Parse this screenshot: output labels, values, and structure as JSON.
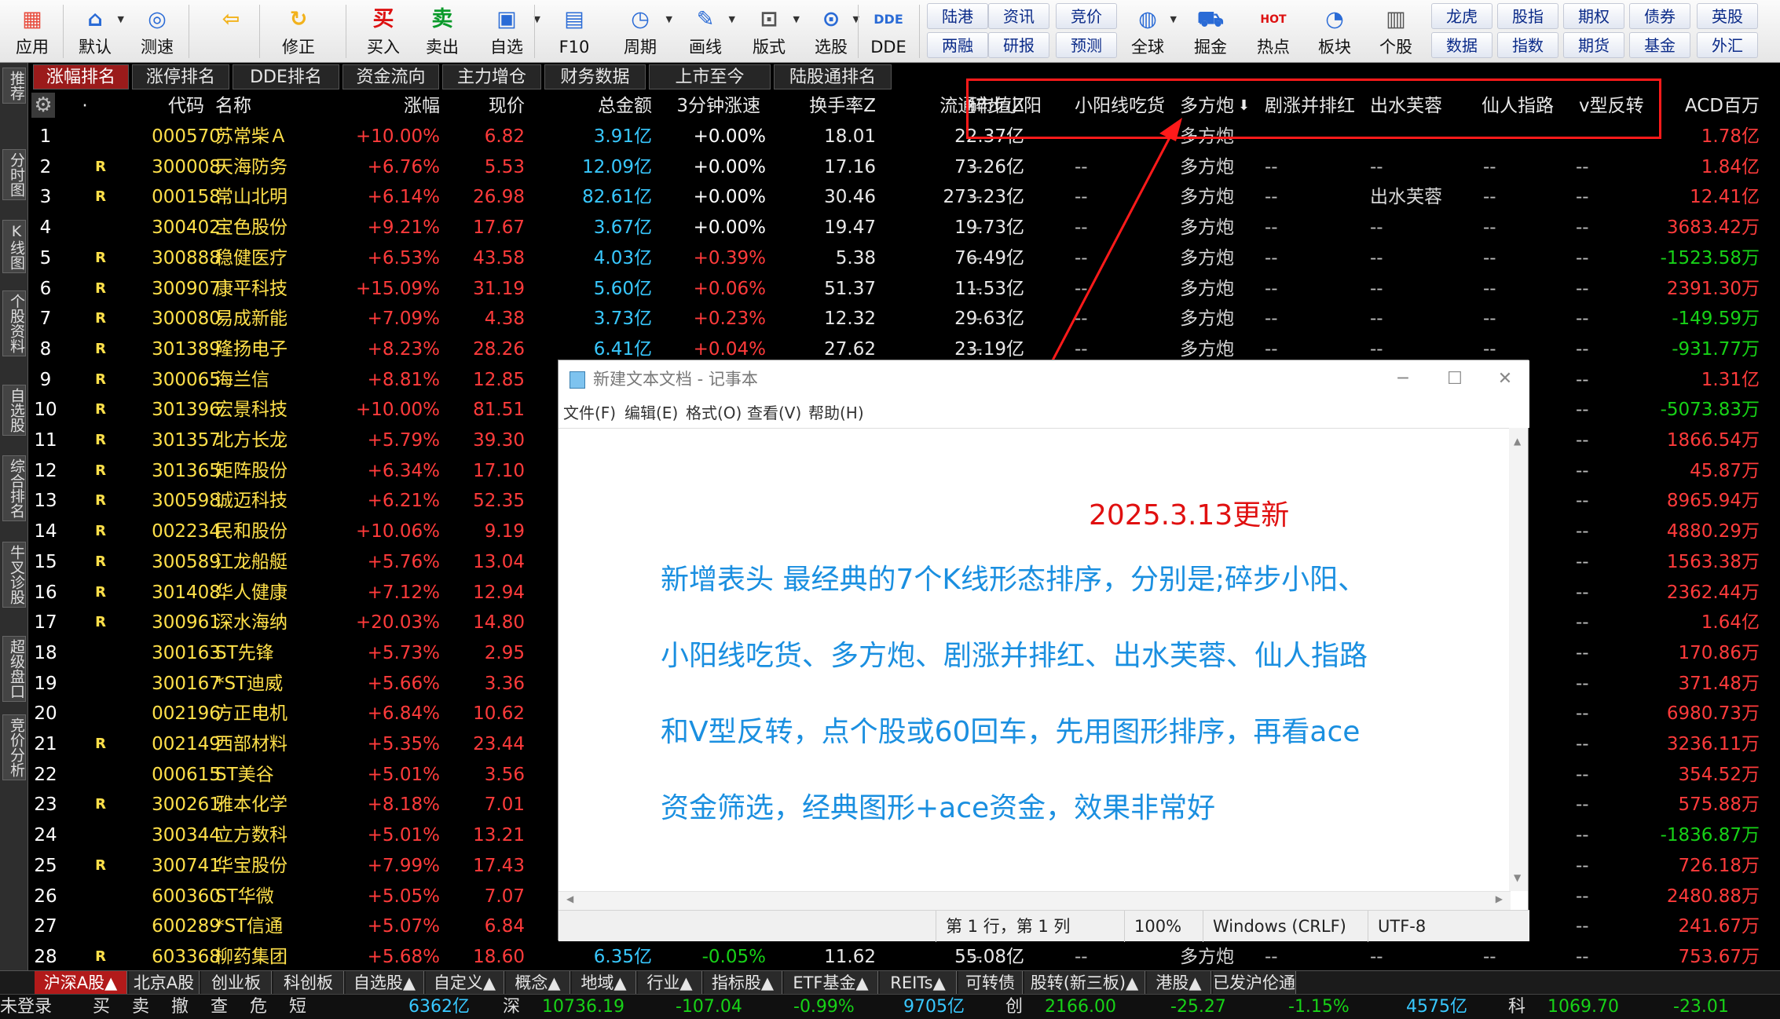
{
  "colors": {
    "up": "#ff3b3b",
    "down": "#17d217",
    "flat": "#ffffff",
    "amount": "#38c8ff",
    "code": "#ffe04a",
    "name": "#ffe04a",
    "idx": "#ffffff",
    "r": "#ffe04a",
    "pattern": "#d8d8d8",
    "dash": "#bbbbbb",
    "highlight": "#ff1a1a",
    "active_tab": "#9b1b1b"
  },
  "toolbar": {
    "items": [
      {
        "label": "应用",
        "icon": "apps-icon",
        "glyph": "▦",
        "color": "#e84b3c"
      },
      {
        "label": "默认",
        "icon": "home-icon",
        "glyph": "⌂",
        "color": "#2a6bd6"
      },
      {
        "label": "测速",
        "icon": "speed-icon",
        "glyph": "◎",
        "color": "#2a6bd6"
      },
      {
        "label": "",
        "icon": "back-arrow-icon",
        "glyph": "⇦",
        "color": "#f2b21c"
      },
      {
        "label": "修正",
        "icon": "correct-icon",
        "glyph": "↻",
        "color": "#f2b21c"
      },
      {
        "label": "买入",
        "icon": "buy-icon",
        "glyph": "买",
        "color": "#d11"
      },
      {
        "label": "卖出",
        "icon": "sell-icon",
        "glyph": "卖",
        "color": "#0a9a2a"
      },
      {
        "label": "自选",
        "icon": "watchlist-icon",
        "glyph": "▣",
        "color": "#2a6bd6"
      },
      {
        "label": "F10",
        "icon": "f10-icon",
        "glyph": "▤",
        "color": "#2a6bd6"
      },
      {
        "label": "周期",
        "icon": "period-icon",
        "glyph": "◷",
        "color": "#2a6bd6"
      },
      {
        "label": "画线",
        "icon": "draw-line-icon",
        "glyph": "✎",
        "color": "#2a6bd6"
      },
      {
        "label": "版式",
        "icon": "layout-icon",
        "glyph": "⊡",
        "color": "#555"
      },
      {
        "label": "选股",
        "icon": "stock-pick-icon",
        "glyph": "⊙",
        "color": "#2a6bd6"
      },
      {
        "label": "DDE",
        "icon": "dde-icon",
        "glyph": "DDE",
        "color": "#2a6bd6"
      }
    ],
    "quick": [
      [
        "陆港",
        "两融"
      ],
      [
        "资讯",
        "研报"
      ],
      [
        "竞价",
        "预测"
      ]
    ],
    "items2": [
      {
        "label": "全球",
        "icon": "globe-icon",
        "glyph": "◍",
        "color": "#2a6bd6"
      },
      {
        "label": "掘金",
        "icon": "cart-icon",
        "glyph": "⛟",
        "color": "#2a6bd6"
      },
      {
        "label": "热点",
        "icon": "hot-icon",
        "glyph": "HOT",
        "color": "#d11"
      },
      {
        "label": "板块",
        "icon": "sector-pie-icon",
        "glyph": "◔",
        "color": "#2a6bd6"
      },
      {
        "label": "个股",
        "icon": "stock-doc-icon",
        "glyph": "▥",
        "color": "#555"
      }
    ],
    "quick2": [
      [
        "龙虎",
        "数据"
      ],
      [
        "股指",
        "指数"
      ],
      [
        "期权",
        "期货"
      ],
      [
        "债券",
        "基金"
      ],
      [
        "英股",
        "外汇"
      ]
    ]
  },
  "sidenav": [
    "推荐",
    "分时图",
    "K线图",
    "个股资料",
    "自选股",
    "综合排名",
    "牛叉诊股",
    "超级盘口",
    "竞价分析"
  ],
  "tabs": [
    "涨幅排名",
    "涨停排名",
    "DDE排名",
    "资金流向",
    "主力增仓",
    "财务数据",
    "上市至今",
    "陆股通排名"
  ],
  "header": [
    "·",
    "代码",
    "名称",
    "涨幅",
    "现价",
    "总金额",
    "3分钟涨速",
    "换手率Z",
    "流通市值Z",
    "碎步小阳",
    "小阳线吃货",
    "多方炮",
    "剧涨并排红",
    "出水芙蓉",
    "仙人指路",
    "v型反转",
    "ACD百万"
  ],
  "rows": [
    {
      "idx": "1",
      "r": "",
      "code": "000570",
      "name": "苏常柴Ａ",
      "chg": "+10.00%",
      "price": "6.82",
      "amt": "3.91亿",
      "speed": "+0.00%",
      "turn": "18.01",
      "mcap": "22.37亿",
      "p1": "",
      "p2": "",
      "p3": "多方炮",
      "p4": "",
      "p5": "",
      "p6": "",
      "p7": "",
      "acd": "1.78亿",
      "acdc": "up"
    },
    {
      "idx": "2",
      "r": "R",
      "code": "300008",
      "name": "天海防务",
      "chg": "+6.76%",
      "price": "5.53",
      "amt": "12.09亿",
      "speed": "+0.00%",
      "turn": "17.16",
      "mcap": "73.26亿",
      "p1": "--",
      "p2": "--",
      "p3": "多方炮",
      "p4": "--",
      "p5": "--",
      "p6": "--",
      "p7": "--",
      "acd": "1.84亿",
      "acdc": "up"
    },
    {
      "idx": "3",
      "r": "R",
      "code": "000158",
      "name": "常山北明",
      "chg": "+6.14%",
      "price": "26.98",
      "amt": "82.61亿",
      "speed": "+0.00%",
      "turn": "30.46",
      "mcap": "273.23亿",
      "p1": "--",
      "p2": "--",
      "p3": "多方炮",
      "p4": "--",
      "p5": "出水芙蓉",
      "p6": "--",
      "p7": "--",
      "acd": "12.41亿",
      "acdc": "up"
    },
    {
      "idx": "4",
      "r": "",
      "code": "300402",
      "name": "宝色股份",
      "chg": "+9.21%",
      "price": "17.67",
      "amt": "3.67亿",
      "speed": "+0.00%",
      "turn": "19.47",
      "mcap": "19.73亿",
      "p1": "--",
      "p2": "--",
      "p3": "多方炮",
      "p4": "--",
      "p5": "--",
      "p6": "--",
      "p7": "--",
      "acd": "3683.42万",
      "acdc": "up"
    },
    {
      "idx": "5",
      "r": "R",
      "code": "300888",
      "name": "稳健医疗",
      "chg": "+6.53%",
      "price": "43.58",
      "amt": "4.03亿",
      "speed": "+0.39%",
      "turn": "5.38",
      "mcap": "76.49亿",
      "p1": "--",
      "p2": "--",
      "p3": "多方炮",
      "p4": "--",
      "p5": "--",
      "p6": "--",
      "p7": "--",
      "acd": "-1523.58万",
      "acdc": "down"
    },
    {
      "idx": "6",
      "r": "R",
      "code": "300907",
      "name": "康平科技",
      "chg": "+15.09%",
      "price": "31.19",
      "amt": "5.60亿",
      "speed": "+0.06%",
      "turn": "51.37",
      "mcap": "11.53亿",
      "p1": "--",
      "p2": "--",
      "p3": "多方炮",
      "p4": "--",
      "p5": "--",
      "p6": "--",
      "p7": "--",
      "acd": "2391.30万",
      "acdc": "up"
    },
    {
      "idx": "7",
      "r": "R",
      "code": "300080",
      "name": "易成新能",
      "chg": "+7.09%",
      "price": "4.38",
      "amt": "3.73亿",
      "speed": "+0.23%",
      "turn": "12.32",
      "mcap": "29.63亿",
      "p1": "--",
      "p2": "--",
      "p3": "多方炮",
      "p4": "--",
      "p5": "--",
      "p6": "--",
      "p7": "--",
      "acd": "-149.59万",
      "acdc": "down"
    },
    {
      "idx": "8",
      "r": "R",
      "code": "301389",
      "name": "隆扬电子",
      "chg": "+8.23%",
      "price": "28.26",
      "amt": "6.41亿",
      "speed": "+0.04%",
      "turn": "27.62",
      "mcap": "23.19亿",
      "p1": "--",
      "p2": "--",
      "p3": "多方炮",
      "p4": "--",
      "p5": "--",
      "p6": "--",
      "p7": "--",
      "acd": "-931.77万",
      "acdc": "down"
    },
    {
      "idx": "9",
      "r": "R",
      "code": "300065",
      "name": "海兰信",
      "chg": "+8.81%",
      "price": "12.85",
      "amt": "",
      "speed": "",
      "turn": "",
      "mcap": "",
      "p1": "",
      "p2": "",
      "p3": "",
      "p4": "",
      "p5": "",
      "p6": "",
      "p7": "--",
      "acd": "1.31亿",
      "acdc": "up"
    },
    {
      "idx": "10",
      "r": "R",
      "code": "301396",
      "name": "宏景科技",
      "chg": "+10.00%",
      "price": "81.51",
      "amt": "",
      "speed": "",
      "turn": "",
      "mcap": "",
      "p1": "",
      "p2": "",
      "p3": "",
      "p4": "",
      "p5": "",
      "p6": "",
      "p7": "--",
      "acd": "-5073.83万",
      "acdc": "down"
    },
    {
      "idx": "11",
      "r": "R",
      "code": "301357",
      "name": "北方长龙",
      "chg": "+5.79%",
      "price": "39.30",
      "amt": "",
      "speed": "",
      "turn": "",
      "mcap": "",
      "p1": "",
      "p2": "",
      "p3": "",
      "p4": "",
      "p5": "",
      "p6": "",
      "p7": "--",
      "acd": "1866.54万",
      "acdc": "up"
    },
    {
      "idx": "12",
      "r": "R",
      "code": "301365",
      "name": "矩阵股份",
      "chg": "+6.34%",
      "price": "17.10",
      "amt": "",
      "speed": "",
      "turn": "",
      "mcap": "",
      "p1": "",
      "p2": "",
      "p3": "",
      "p4": "",
      "p5": "",
      "p6": "",
      "p7": "--",
      "acd": "45.87万",
      "acdc": "up"
    },
    {
      "idx": "13",
      "r": "R",
      "code": "300598",
      "name": "诚迈科技",
      "chg": "+6.21%",
      "price": "52.35",
      "amt": "",
      "speed": "",
      "turn": "",
      "mcap": "",
      "p1": "",
      "p2": "",
      "p3": "",
      "p4": "",
      "p5": "",
      "p6": "",
      "p7": "--",
      "acd": "8965.94万",
      "acdc": "up"
    },
    {
      "idx": "14",
      "r": "R",
      "code": "002234",
      "name": "民和股份",
      "chg": "+10.06%",
      "price": "9.19",
      "amt": "",
      "speed": "",
      "turn": "",
      "mcap": "",
      "p1": "",
      "p2": "",
      "p3": "",
      "p4": "",
      "p5": "",
      "p6": "",
      "p7": "--",
      "acd": "4880.29万",
      "acdc": "up"
    },
    {
      "idx": "15",
      "r": "R",
      "code": "300589",
      "name": "江龙船艇",
      "chg": "+5.76%",
      "price": "13.04",
      "amt": "",
      "speed": "",
      "turn": "",
      "mcap": "",
      "p1": "",
      "p2": "",
      "p3": "",
      "p4": "",
      "p5": "",
      "p6": "",
      "p7": "--",
      "acd": "1563.38万",
      "acdc": "up"
    },
    {
      "idx": "16",
      "r": "R",
      "code": "301408",
      "name": "华人健康",
      "chg": "+7.12%",
      "price": "12.94",
      "amt": "",
      "speed": "",
      "turn": "",
      "mcap": "",
      "p1": "",
      "p2": "",
      "p3": "",
      "p4": "",
      "p5": "",
      "p6": "",
      "p7": "--",
      "acd": "2362.44万",
      "acdc": "up"
    },
    {
      "idx": "17",
      "r": "R",
      "code": "300961",
      "name": "深水海纳",
      "chg": "+20.03%",
      "price": "14.80",
      "amt": "",
      "speed": "",
      "turn": "",
      "mcap": "",
      "p1": "",
      "p2": "",
      "p3": "",
      "p4": "",
      "p5": "",
      "p6": "",
      "p7": "--",
      "acd": "1.64亿",
      "acdc": "up"
    },
    {
      "idx": "18",
      "r": "",
      "code": "300163",
      "name": "ST先锋",
      "chg": "+5.73%",
      "price": "2.95",
      "amt": "",
      "speed": "",
      "turn": "",
      "mcap": "",
      "p1": "",
      "p2": "",
      "p3": "",
      "p4": "",
      "p5": "",
      "p6": "",
      "p7": "--",
      "acd": "170.86万",
      "acdc": "up"
    },
    {
      "idx": "19",
      "r": "",
      "code": "300167",
      "name": "*ST迪威",
      "chg": "+5.66%",
      "price": "3.36",
      "amt": "",
      "speed": "",
      "turn": "",
      "mcap": "",
      "p1": "",
      "p2": "",
      "p3": "",
      "p4": "",
      "p5": "",
      "p6": "",
      "p7": "--",
      "acd": "371.48万",
      "acdc": "up"
    },
    {
      "idx": "20",
      "r": "",
      "code": "002196",
      "name": "方正电机",
      "chg": "+6.84%",
      "price": "10.62",
      "amt": "",
      "speed": "",
      "turn": "",
      "mcap": "",
      "p1": "",
      "p2": "",
      "p3": "",
      "p4": "",
      "p5": "",
      "p6": "",
      "p7": "--",
      "acd": "6980.73万",
      "acdc": "up"
    },
    {
      "idx": "21",
      "r": "R",
      "code": "002149",
      "name": "西部材料",
      "chg": "+5.35%",
      "price": "23.44",
      "amt": "",
      "speed": "",
      "turn": "",
      "mcap": "",
      "p1": "",
      "p2": "",
      "p3": "",
      "p4": "",
      "p5": "",
      "p6": "",
      "p7": "--",
      "acd": "3236.11万",
      "acdc": "up"
    },
    {
      "idx": "22",
      "r": "",
      "code": "000615",
      "name": "ST美谷",
      "chg": "+5.01%",
      "price": "3.56",
      "amt": "",
      "speed": "",
      "turn": "",
      "mcap": "",
      "p1": "",
      "p2": "",
      "p3": "",
      "p4": "",
      "p5": "",
      "p6": "",
      "p7": "--",
      "acd": "354.52万",
      "acdc": "up"
    },
    {
      "idx": "23",
      "r": "R",
      "code": "300261",
      "name": "雅本化学",
      "chg": "+8.18%",
      "price": "7.01",
      "amt": "",
      "speed": "",
      "turn": "",
      "mcap": "",
      "p1": "",
      "p2": "",
      "p3": "",
      "p4": "",
      "p5": "",
      "p6": "",
      "p7": "--",
      "acd": "575.88万",
      "acdc": "up"
    },
    {
      "idx": "24",
      "r": "",
      "code": "300344",
      "name": "立方数科",
      "chg": "+5.01%",
      "price": "13.21",
      "amt": "",
      "speed": "",
      "turn": "",
      "mcap": "",
      "p1": "",
      "p2": "",
      "p3": "",
      "p4": "",
      "p5": "",
      "p6": "",
      "p7": "--",
      "acd": "-1836.87万",
      "acdc": "down"
    },
    {
      "idx": "25",
      "r": "R",
      "code": "300741",
      "name": "华宝股份",
      "chg": "+7.99%",
      "price": "17.43",
      "amt": "",
      "speed": "",
      "turn": "",
      "mcap": "",
      "p1": "",
      "p2": "",
      "p3": "",
      "p4": "",
      "p5": "",
      "p6": "",
      "p7": "--",
      "acd": "726.18万",
      "acdc": "up"
    },
    {
      "idx": "26",
      "r": "",
      "code": "600360",
      "name": "ST华微",
      "chg": "+5.05%",
      "price": "7.07",
      "amt": "",
      "speed": "",
      "turn": "",
      "mcap": "",
      "p1": "",
      "p2": "",
      "p3": "",
      "p4": "",
      "p5": "",
      "p6": "",
      "p7": "--",
      "acd": "2480.88万",
      "acdc": "up"
    },
    {
      "idx": "27",
      "r": "",
      "code": "600289",
      "name": "*ST信通",
      "chg": "+5.07%",
      "price": "6.84",
      "amt": "",
      "speed": "",
      "turn": "",
      "mcap": "",
      "p1": "",
      "p2": "",
      "p3": "",
      "p4": "",
      "p5": "",
      "p6": "",
      "p7": "--",
      "acd": "241.67万",
      "acdc": "up"
    },
    {
      "idx": "28",
      "r": "R",
      "code": "603368",
      "name": "柳药集团",
      "chg": "+5.68%",
      "price": "18.60",
      "amt": "6.35亿",
      "speed": "-0.05%",
      "turn": "11.62",
      "mcap": "55.08亿",
      "p1": "--",
      "p2": "--",
      "p3": "多方炮",
      "p4": "--",
      "p5": "--",
      "p6": "--",
      "p7": "--",
      "acd": "753.67万",
      "acdc": "up"
    }
  ],
  "notepad": {
    "title": "新建文本文档 - 记事本",
    "menu": [
      "文件(F)",
      "编辑(E)",
      "格式(O)",
      "查看(V)",
      "帮助(H)"
    ],
    "date": "2025.3.13更新",
    "lines": [
      "新增表头 最经典的7个K线形态排序，分别是;碎步小阳、",
      "小阳线吃货、多方炮、剧涨并排红、出水芙蓉、仙人指路",
      "和V型反转，点个股或60回车，先用图形排序，再看ace",
      "资金筛选，经典图形+ace资金，效果非常好"
    ],
    "status": {
      "pos": "第 1 行，第 1 列",
      "zoom": "100%",
      "eol": "Windows (CRLF)",
      "enc": "UTF-8"
    }
  },
  "bottom_tabs": [
    "沪深A股▲",
    "北京A股",
    "创业板",
    "科创板",
    "自选股▲",
    "自定义▲",
    "概念▲",
    "地域▲",
    "行业▲",
    "指标股▲",
    "ETF基金▲",
    "REITs▲",
    "可转债",
    "股转(新三板)▲",
    "港股▲",
    "已发沪伦通"
  ],
  "status_bar": [
    {
      "t": "未登录",
      "c": "#ddd"
    },
    {
      "t": "买",
      "c": "#ddd"
    },
    {
      "t": "卖",
      "c": "#ddd"
    },
    {
      "t": "撤",
      "c": "#ddd"
    },
    {
      "t": "查",
      "c": "#ddd"
    },
    {
      "t": "危",
      "c": "#ddd"
    },
    {
      "t": "短",
      "c": "#ddd"
    },
    {
      "t": "6362亿",
      "c": "#38c8ff"
    },
    {
      "t": "深",
      "c": "#ddd"
    },
    {
      "t": "10736.19",
      "c": "#17d217"
    },
    {
      "t": "-107.04",
      "c": "#17d217"
    },
    {
      "t": "-0.99%",
      "c": "#17d217"
    },
    {
      "t": "9705亿",
      "c": "#38c8ff"
    },
    {
      "t": "创",
      "c": "#ddd"
    },
    {
      "t": "2166.00",
      "c": "#17d217"
    },
    {
      "t": "-25.27",
      "c": "#17d217"
    },
    {
      "t": "-1.15%",
      "c": "#17d217"
    },
    {
      "t": "4575亿",
      "c": "#38c8ff"
    },
    {
      "t": "科",
      "c": "#ddd"
    },
    {
      "t": "1069.70",
      "c": "#17d217"
    },
    {
      "t": "-23.01",
      "c": "#17d217"
    }
  ]
}
